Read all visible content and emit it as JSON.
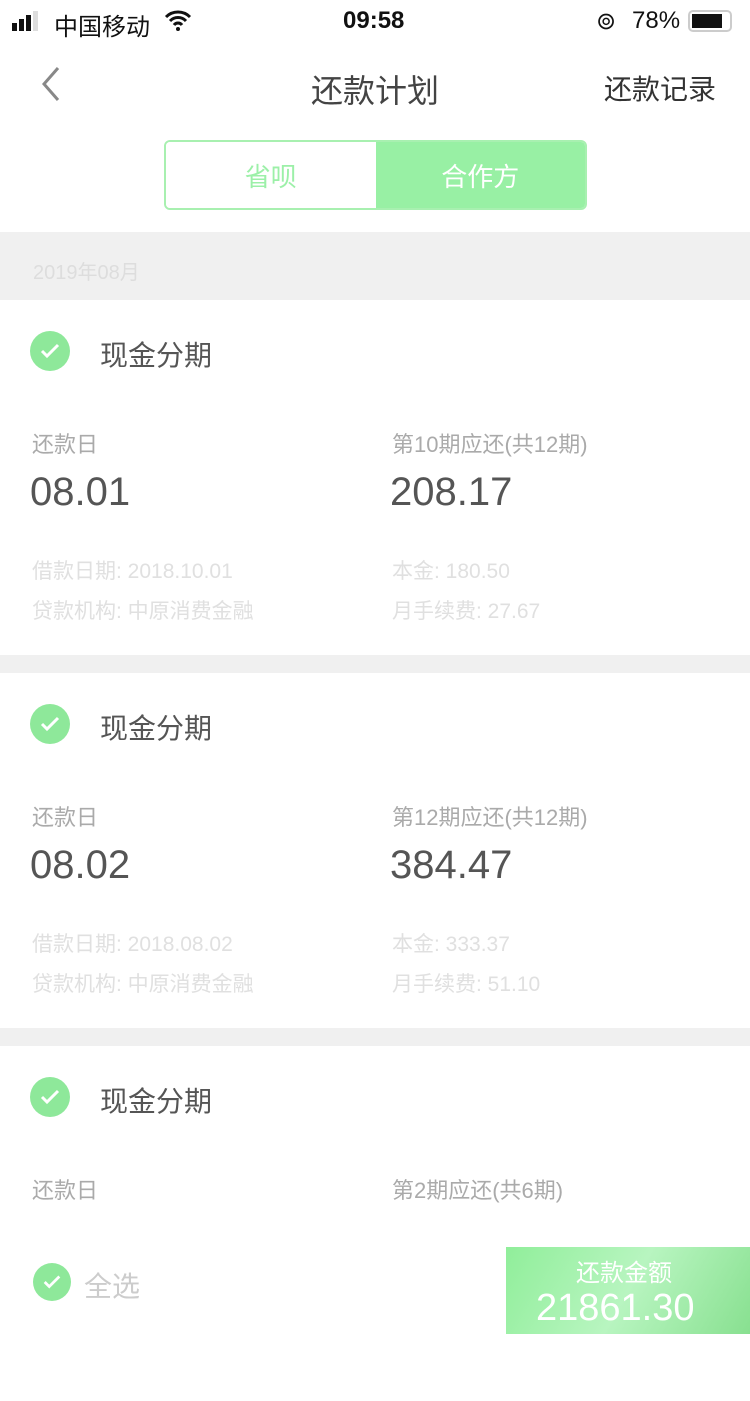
{
  "status_bar": {
    "carrier": "中国移动",
    "time": "09:58",
    "battery": "78%"
  },
  "nav": {
    "title": "还款计划",
    "right_link": "还款记录"
  },
  "segments": [
    {
      "label": "省呗",
      "active": false
    },
    {
      "label": "合作方",
      "active": true
    }
  ],
  "month": "2019年08月",
  "accent_color": "#8ee89a",
  "cards": [
    {
      "title": "现金分期",
      "due_label": "还款日",
      "due": "08.01",
      "amount_label": "第10期应还(共12期)",
      "amount": "208.17",
      "loan_date": "借款日期: 2018.10.01",
      "principal": "本金: 180.50",
      "lender": "贷款机构: 中原消费金融",
      "fee": "月手续费: 27.67"
    },
    {
      "title": "现金分期",
      "due_label": "还款日",
      "due": "08.02",
      "amount_label": "第12期应还(共12期)",
      "amount": "384.47",
      "loan_date": "借款日期: 2018.08.02",
      "principal": "本金: 333.37",
      "lender": "贷款机构: 中原消费金融",
      "fee": "月手续费: 51.10"
    },
    {
      "title": "现金分期",
      "due_label": "还款日",
      "amount_label": "第2期应还(共6期)"
    }
  ],
  "bottom": {
    "select_all": "全选",
    "pay_label": "还款金额",
    "pay_amount": "21861.30"
  }
}
